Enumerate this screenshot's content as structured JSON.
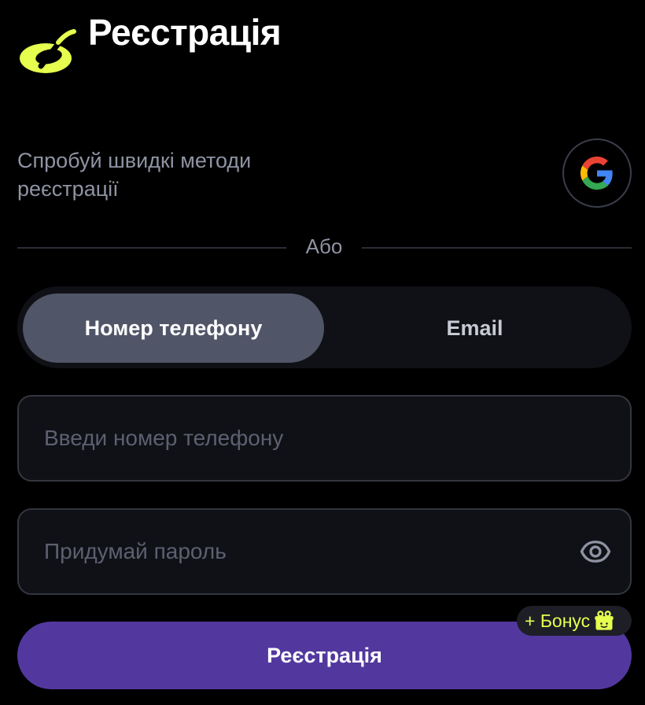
{
  "header": {
    "title": "Реєстрація",
    "logo_icon": "brand-logo-icon",
    "logo_color": "#e6ff4f"
  },
  "quick_methods": {
    "text": "Спробуй швидкі методи реєстрації",
    "google_icon": "google-icon"
  },
  "divider": {
    "label": "Або"
  },
  "tabs": [
    {
      "label": "Номер телефону",
      "active": true
    },
    {
      "label": "Email",
      "active": false
    }
  ],
  "form": {
    "phone_placeholder": "Введи номер телефону",
    "phone_value": "",
    "password_placeholder": "Придумай пароль",
    "password_value": "",
    "password_toggle_icon": "eye-icon"
  },
  "submit": {
    "label": "Реєстрація",
    "color": "#52389e"
  },
  "bonus": {
    "label": "+ Бонус",
    "icon": "gift-icon",
    "color": "#e6ff4f"
  }
}
